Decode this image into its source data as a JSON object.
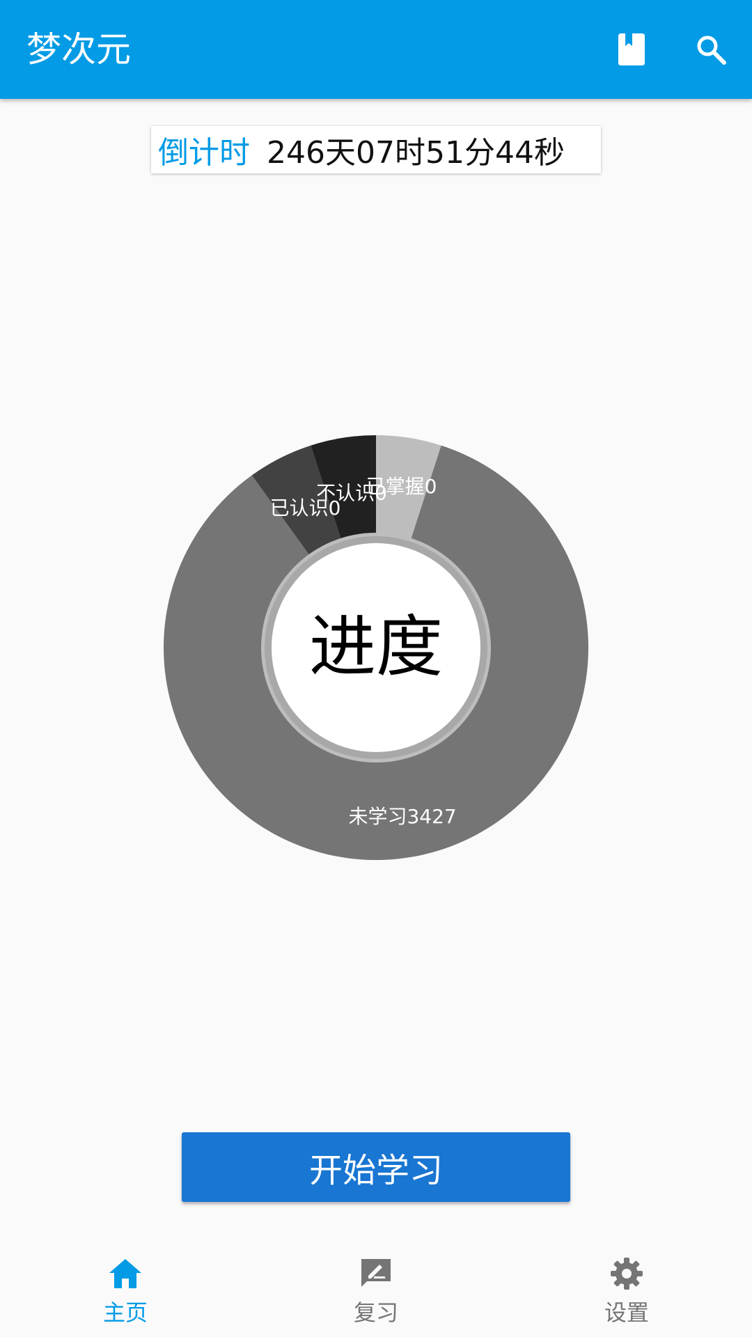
{
  "app_bar": {
    "title": "梦次元",
    "icons": [
      "bookmark-icon",
      "search-icon"
    ],
    "color": "#039be5"
  },
  "countdown": {
    "label": "倒计时",
    "value": "246天07时51分44秒"
  },
  "chart_data": {
    "type": "pie",
    "center_label": "进度",
    "slices": [
      {
        "label": "已掌握0",
        "value": 200,
        "color": "#bdbdbd"
      },
      {
        "label": "未学习3427",
        "value": 3427,
        "color": "#757575"
      },
      {
        "label": "已认识0",
        "value": 200,
        "color": "#424242"
      },
      {
        "label": "不认识0",
        "value": 200,
        "color": "#212121"
      }
    ]
  },
  "start_button": {
    "label": "开始学习",
    "color": "#1976d2"
  },
  "bottom_nav": {
    "items": [
      {
        "label": "主页",
        "icon": "home-icon",
        "active": true
      },
      {
        "label": "复习",
        "icon": "review-icon",
        "active": false
      },
      {
        "label": "设置",
        "icon": "settings-icon",
        "active": false
      }
    ],
    "active_color": "#039be5",
    "inactive_color": "#757575"
  }
}
